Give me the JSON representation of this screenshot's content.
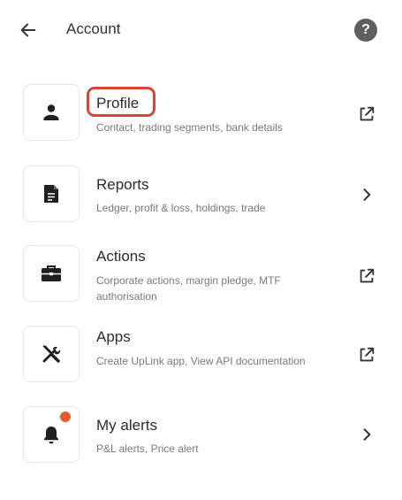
{
  "header": {
    "title": "Account",
    "back_icon": "arrow-left-icon",
    "help_icon": "question-circle-icon",
    "help_glyph": "?"
  },
  "menu": [
    {
      "title": "Profile",
      "subtitle": "Contact, trading segments, bank details",
      "icon": "user-icon",
      "trail_icon": "external-link-icon"
    },
    {
      "title": "Reports",
      "subtitle": "Ledger, profit & loss, holdings, trade",
      "icon": "document-icon",
      "trail_icon": "chevron-right-icon"
    },
    {
      "title": "Actions",
      "subtitle": "Corporate actions, margin pledge, MTF authorisation",
      "icon": "briefcase-icon",
      "trail_icon": "external-link-icon"
    },
    {
      "title": "Apps",
      "subtitle": "Create UpLink app, View API documentation",
      "icon": "tools-icon",
      "trail_icon": "external-link-icon"
    },
    {
      "title": "My alerts",
      "subtitle": "P&L alerts, Price alert",
      "icon": "bell-icon",
      "trail_icon": "chevron-right-icon",
      "has_notification": true
    }
  ],
  "colors": {
    "highlight": "#d9433a",
    "notification_dot": "#e65a2c",
    "icon": "#1f1f1f"
  }
}
